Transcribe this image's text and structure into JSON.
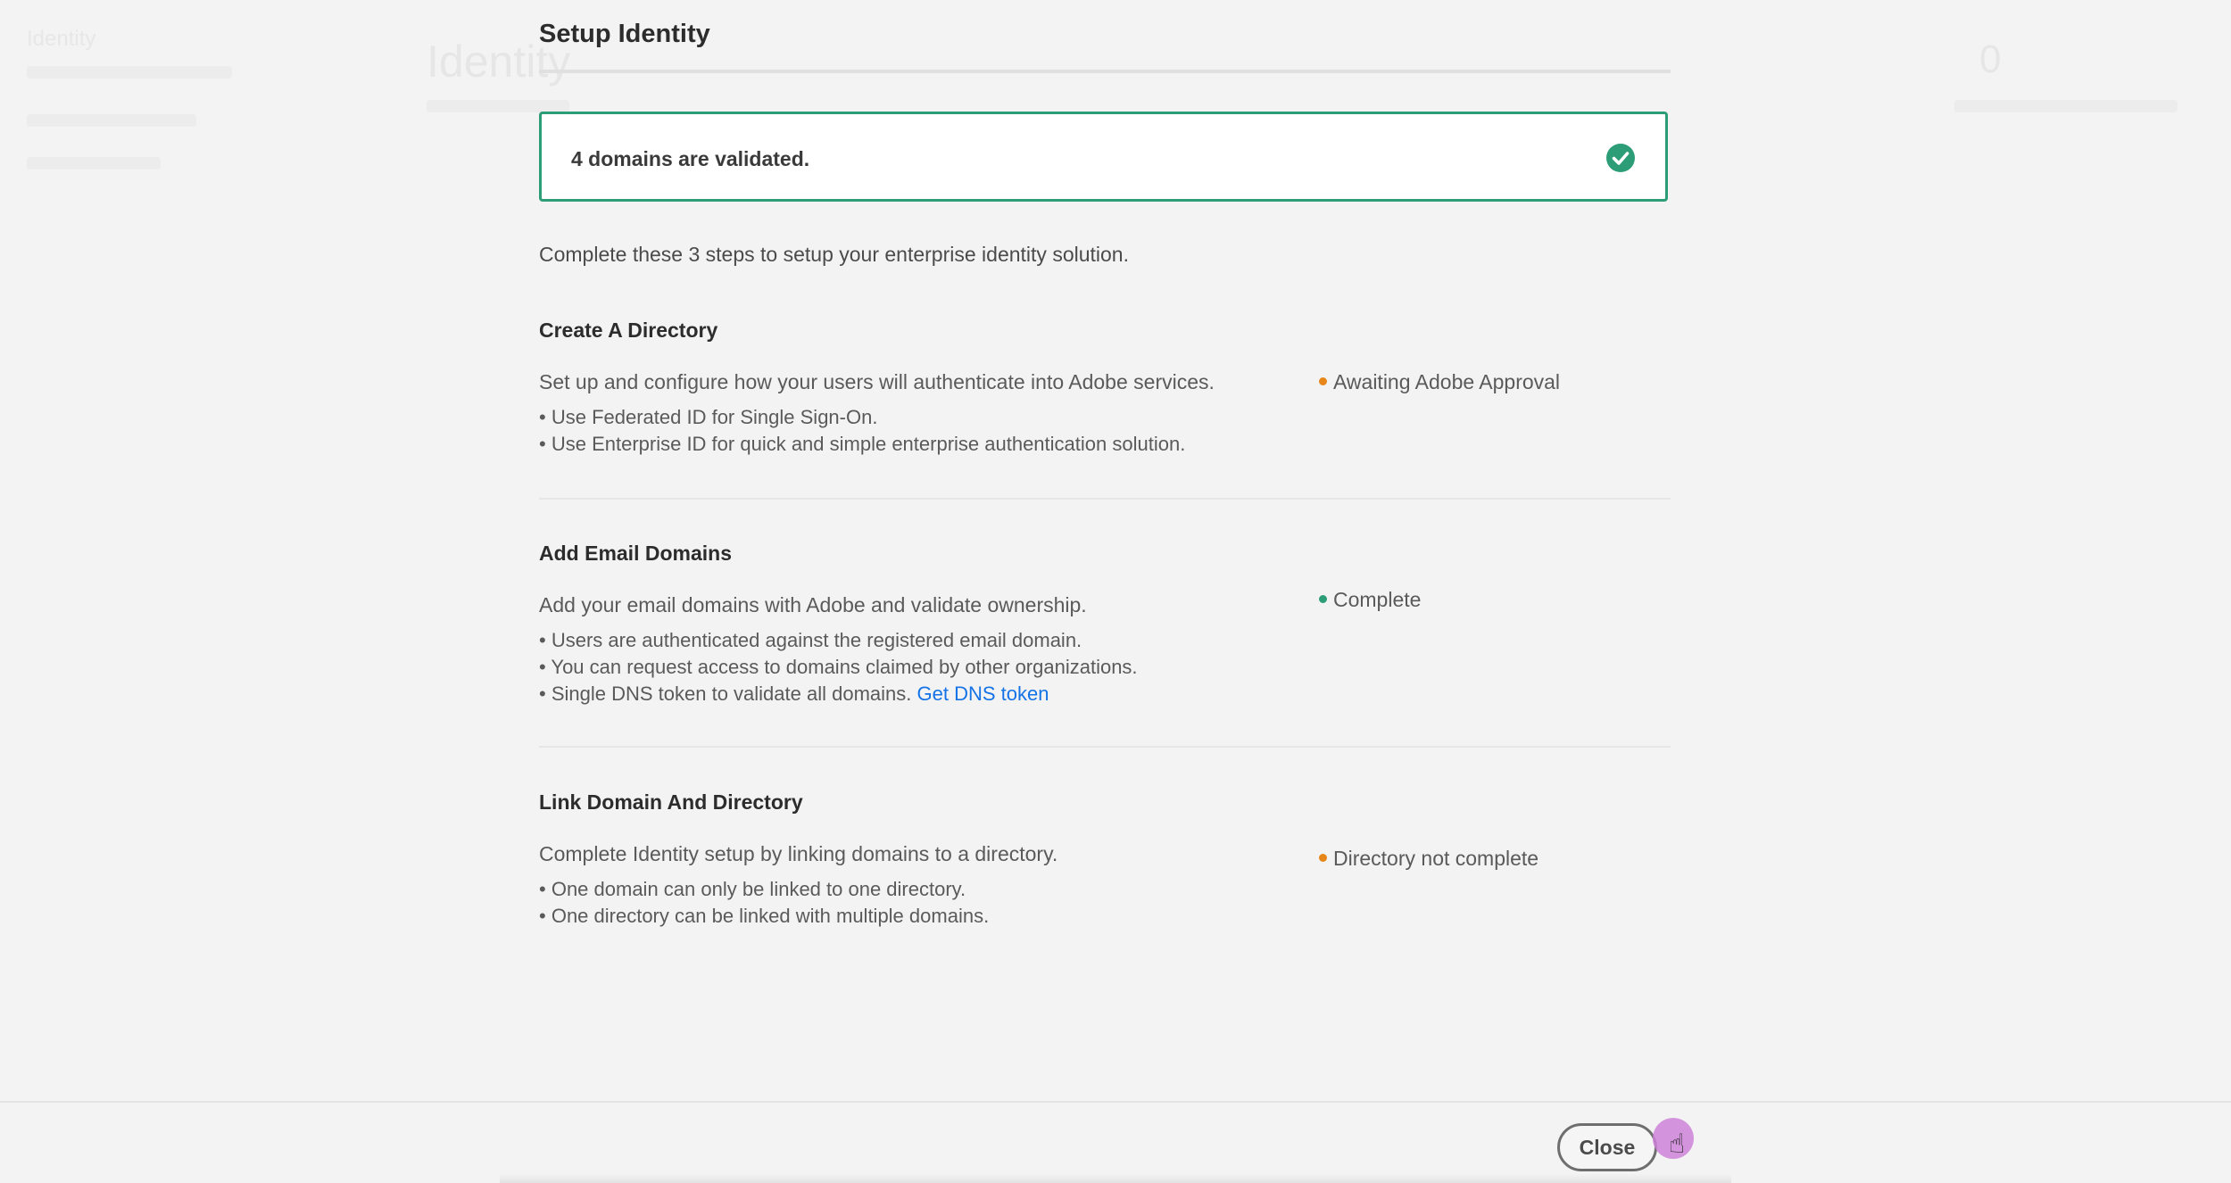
{
  "background": {
    "app_title": "Identity",
    "heading": "Identity",
    "count": "0"
  },
  "dialog": {
    "title": "Setup Identity",
    "alert": {
      "message": "4 domains are validated.",
      "icon": "checkmark-circle-icon",
      "color": "#2d9d78"
    },
    "intro": "Complete these 3 steps to setup your enterprise identity solution.",
    "steps": [
      {
        "title": "Create A Directory",
        "description": "Set up and configure how your users will authenticate into Adobe services.",
        "bullets": [
          "Use Federated ID for Single Sign-On.",
          "Use Enterprise ID for quick and simple enterprise authentication solution."
        ],
        "status": "Awaiting Adobe Approval",
        "status_color": "#e68619"
      },
      {
        "title": "Add Email Domains",
        "description": "Add your email domains with Adobe and validate ownership.",
        "bullets": [
          "Users are authenticated against the registered email domain.",
          "You can request access to domains claimed by other organizations.",
          "Single DNS token to validate all domains."
        ],
        "link": "Get DNS token",
        "status": "Complete",
        "status_color": "#2d9d78"
      },
      {
        "title": "Link Domain And Directory",
        "description": "Complete Identity setup by linking domains to a directory.",
        "bullets": [
          "One domain can only be linked to one directory.",
          "One directory can be linked with multiple domains."
        ],
        "status": "Directory not complete",
        "status_color": "#e68619"
      }
    ],
    "close_label": "Close"
  },
  "colors": {
    "link": "#1473e6",
    "background": "#f3f3f3"
  }
}
